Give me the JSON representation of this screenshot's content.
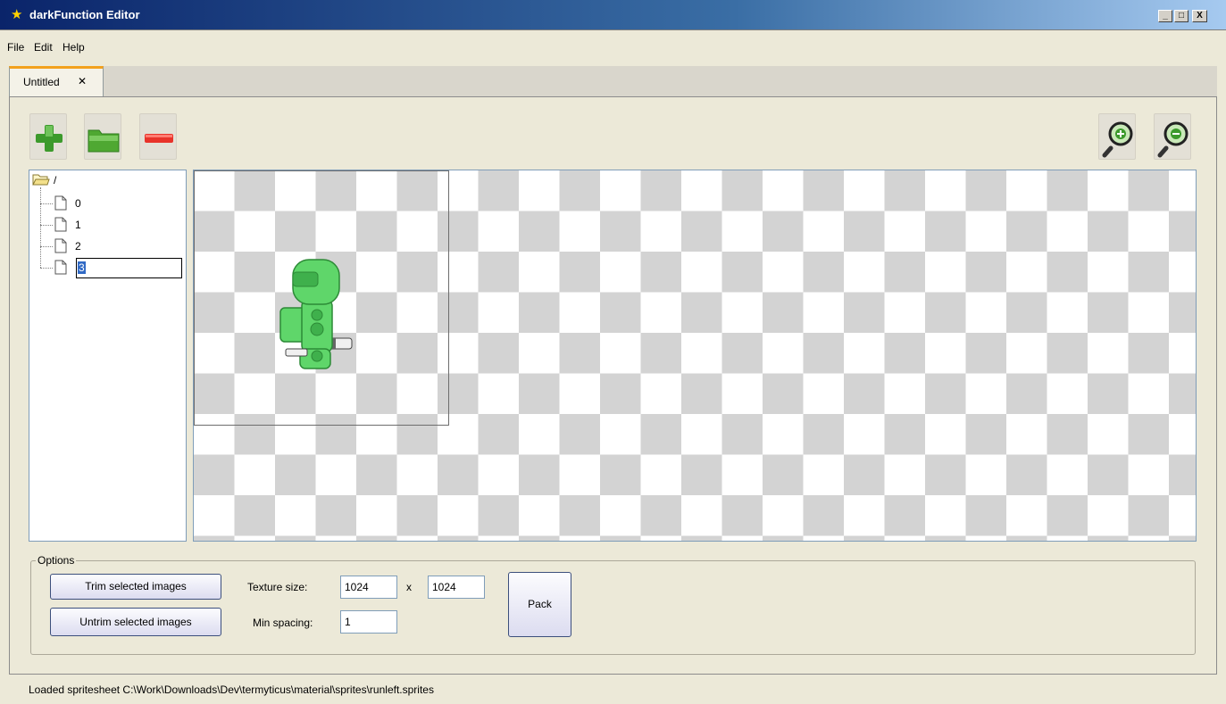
{
  "window": {
    "title": "darkFunction Editor",
    "controls": {
      "minimize": "_",
      "maximize": "□",
      "close": "X"
    }
  },
  "menu": [
    "File",
    "Edit",
    "Help"
  ],
  "tabs": [
    {
      "label": "Untitled",
      "close": "✕"
    }
  ],
  "toolbar": {
    "add": "plus-icon",
    "open": "folder-icon",
    "remove": "minus-icon",
    "zoom_in": "zoom-in-icon",
    "zoom_out": "zoom-out-icon"
  },
  "tree": {
    "root": "/",
    "items": [
      "0",
      "1",
      "2"
    ],
    "editing": "3"
  },
  "options": {
    "legend": "Options",
    "trim_label": "Trim selected images",
    "untrim_label": "Untrim selected images",
    "texture_size_label": "Texture size:",
    "texture_width": "1024",
    "times": "x",
    "texture_height": "1024",
    "min_spacing_label": "Min spacing:",
    "min_spacing": "1",
    "pack_label": "Pack"
  },
  "status": "Loaded spritesheet C:\\Work\\Downloads\\Dev\\termyticus\\material\\sprites\\runleft.sprites",
  "colors": {
    "accent_tab": "#f2a11e",
    "sprite_green": "#5fd66a",
    "titlebar": "#0a246a"
  }
}
